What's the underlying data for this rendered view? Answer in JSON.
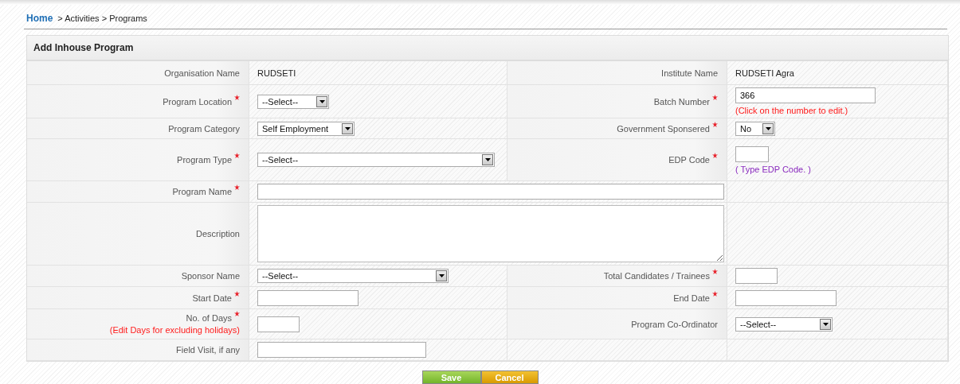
{
  "breadcrumb": {
    "home": "Home",
    "trail": "> Activities > Programs"
  },
  "form": {
    "title": "Add Inhouse Program",
    "rows": [
      {
        "left": {
          "label": "Organisation Name",
          "required": false,
          "kind": "text",
          "value": "RUDSETI"
        },
        "right": {
          "label": "Institute Name",
          "required": false,
          "kind": "text",
          "value": "RUDSETI Agra"
        }
      },
      {
        "left": {
          "label": "Program Location",
          "required": true,
          "kind": "select",
          "value": "--Select--"
        },
        "right": {
          "label": "Batch Number",
          "required": true,
          "kind": "input",
          "value": "366",
          "hint": "(Click on the number to edit.)",
          "color": "#ff1a1a"
        }
      },
      {
        "left": {
          "label": "Program Category",
          "required": false,
          "kind": "select",
          "value": "Self Employment"
        },
        "right": {
          "label": "Government Sponsered",
          "required": true,
          "kind": "select",
          "value": "No"
        }
      },
      {
        "left": {
          "label": "Program Type",
          "required": true,
          "kind": "select",
          "value": "--Select--"
        },
        "right": {
          "label": "EDP Code",
          "required": true,
          "kind": "input",
          "hint": "( Type EDP Code. )",
          "color": "#8a2bbf"
        }
      },
      {
        "left": {
          "label": "Program Name",
          "required": true,
          "kind": "input",
          "wide": true
        }
      },
      {
        "left": {
          "label": "Description",
          "required": false,
          "kind": "textarea",
          "wide": true
        }
      },
      {
        "left": {
          "label": "Sponsor Name",
          "required": false,
          "kind": "select",
          "value": "--Select--"
        },
        "right": {
          "label": "Total Candidates / Trainees",
          "required": true,
          "kind": "input"
        }
      },
      {
        "left": {
          "label": "Start Date",
          "required": true,
          "kind": "input"
        },
        "right": {
          "label": "End Date",
          "required": true,
          "kind": "input"
        }
      },
      {
        "left": {
          "label": "No. of Days",
          "required": true,
          "kind": "input",
          "label_hint": "(Edit Days for excluding holidays)"
        },
        "right": {
          "label": "Program Co-Ordinator",
          "required": false,
          "kind": "select",
          "value": "--Select--"
        }
      },
      {
        "left": {
          "label": "Field Visit, if any",
          "required": false,
          "kind": "input"
        }
      }
    ]
  },
  "buttons": [
    {
      "label": "Save",
      "kind": "save"
    },
    {
      "label": "Cancel",
      "kind": "cancel"
    }
  ]
}
